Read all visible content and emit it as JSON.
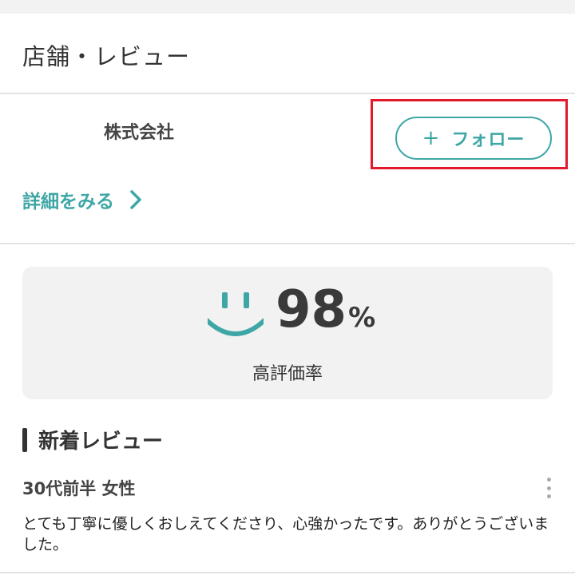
{
  "section_title": "店舗・レビュー",
  "shop": {
    "name": "株式会社",
    "follow_label": "フォロー",
    "follow_plus": "+",
    "detail_label": "詳細をみる"
  },
  "rating": {
    "value": "98",
    "unit": "%",
    "label": "高評価率"
  },
  "reviews": {
    "heading": "新着レビュー",
    "items": [
      {
        "reviewer": "30代前半 女性",
        "text": "とても丁寧に優しくおしえてくださり、心強かったです。ありがとうございました。"
      }
    ]
  },
  "colors": {
    "accent": "#3fa6a6",
    "highlight": "#e21a2c",
    "card_bg": "#f2f2f2"
  },
  "icons": [
    "plus-icon",
    "chevron-right-icon",
    "smile-icon",
    "kebab-menu-icon"
  ]
}
